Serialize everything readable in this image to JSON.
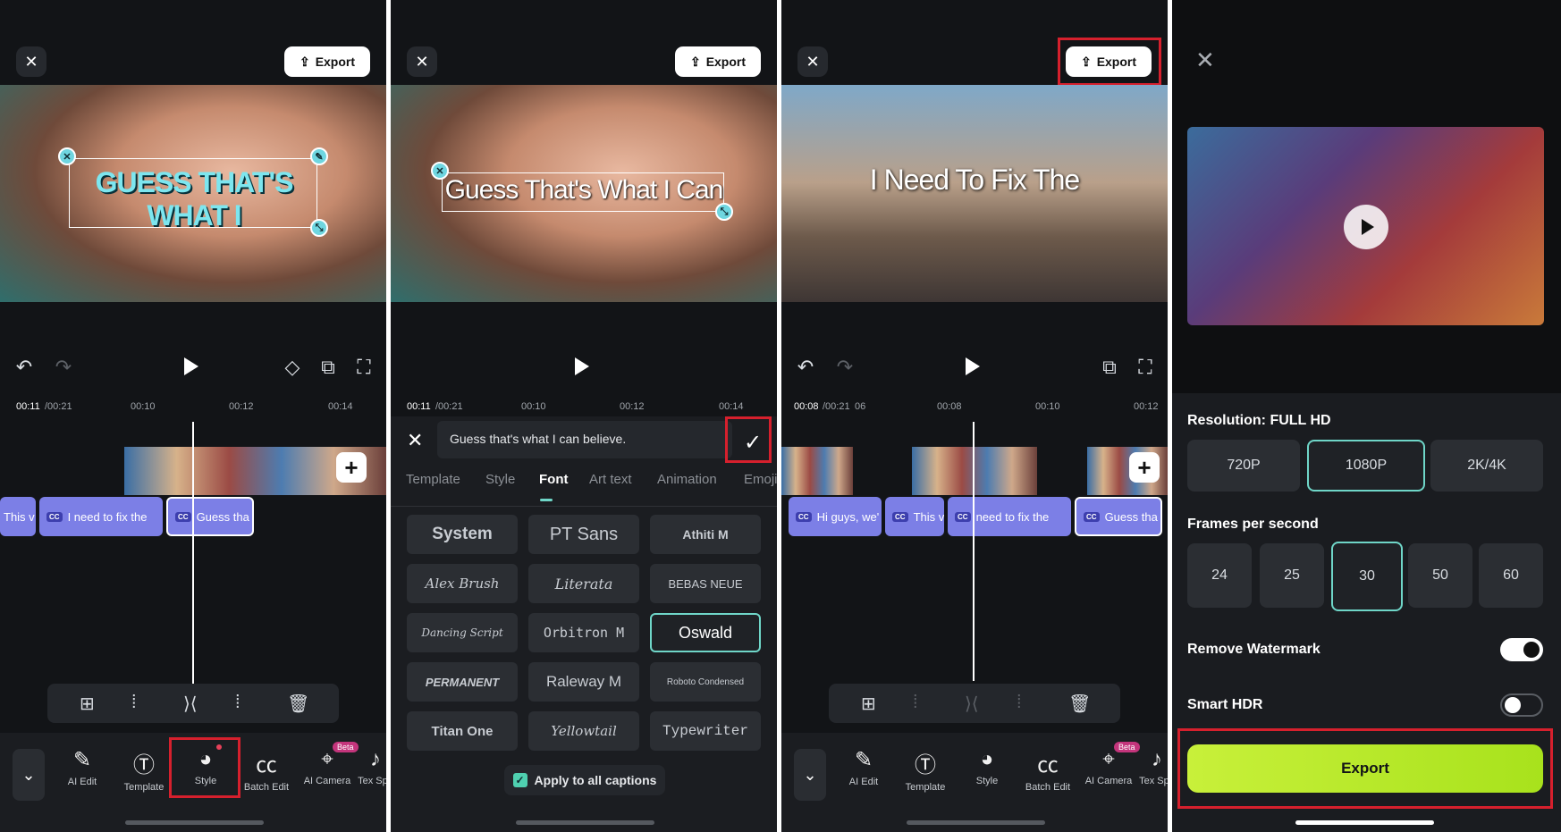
{
  "common": {
    "export_label": "Export",
    "close_glyph": "✕",
    "export_glyph": "⇪",
    "timeline_clips": [
      "This v",
      "I need to fix the",
      "Guess tha"
    ]
  },
  "panel1": {
    "caption_text": "GUESS THAT'S WHAT I",
    "ruler": {
      "current": "00:11",
      "total": "/00:21",
      "t1": "00:10",
      "t2": "00:12",
      "t3": "00:14"
    },
    "tabs": [
      "AI Edit",
      "Template",
      "Style",
      "Batch Edit",
      "AI Camera",
      "Tex Spe"
    ],
    "beta_label": "Beta"
  },
  "panel2": {
    "caption_text": "Guess That's What I Can",
    "ruler": {
      "current": "00:11",
      "total": "/00:21",
      "t1": "00:10",
      "t2": "00:12",
      "t3": "00:14"
    },
    "text_value": "Guess that's what I can believe.",
    "tabs": [
      "Template",
      "Style",
      "Font",
      "Art text",
      "Animation",
      "Emoji"
    ],
    "active_tab": "Font",
    "fonts": [
      [
        "System",
        "PT Sans",
        "Athiti M"
      ],
      [
        "Alex Brush",
        "Literata",
        "BEBAS NEUE"
      ],
      [
        "Dancing Script",
        "Orbitron M",
        "Oswald"
      ],
      [
        "PERMANENT",
        "Raleway M",
        "Roboto Condensed"
      ],
      [
        "Titan One",
        "Yellowtail",
        "Typewriter"
      ]
    ],
    "selected_font": "Oswald",
    "apply_all_label": "Apply to all captions"
  },
  "panel3": {
    "caption_text": "I Need To Fix The",
    "ruler": {
      "current": "00:08",
      "total": "/00:21",
      "t0": "06",
      "t1": "00:08",
      "t2": "00:10",
      "t3": "00:12"
    },
    "clips": [
      "Hi guys, we'",
      "This v",
      "need to fix the",
      "Guess tha"
    ],
    "tabs": [
      "AI Edit",
      "Template",
      "Style",
      "Batch Edit",
      "AI Camera",
      "Tex Spe"
    ],
    "beta_label": "Beta"
  },
  "panel4": {
    "resolution_label": "Resolution: FULL HD",
    "resolutions": [
      "720P",
      "1080P",
      "2K/4K"
    ],
    "selected_resolution": "1080P",
    "fps_label": "Frames per second",
    "fps_options": [
      "24",
      "25",
      "30",
      "50",
      "60"
    ],
    "selected_fps": "30",
    "watermark_label": "Remove Watermark",
    "watermark_on": true,
    "hdr_label": "Smart HDR",
    "hdr_on": false,
    "export_label": "Export"
  },
  "colors": {
    "accent": "#6fd6c8",
    "highlight_box": "#d6202d",
    "export_green": "#c8f03a",
    "caption_clip": "#7c7fe6"
  }
}
